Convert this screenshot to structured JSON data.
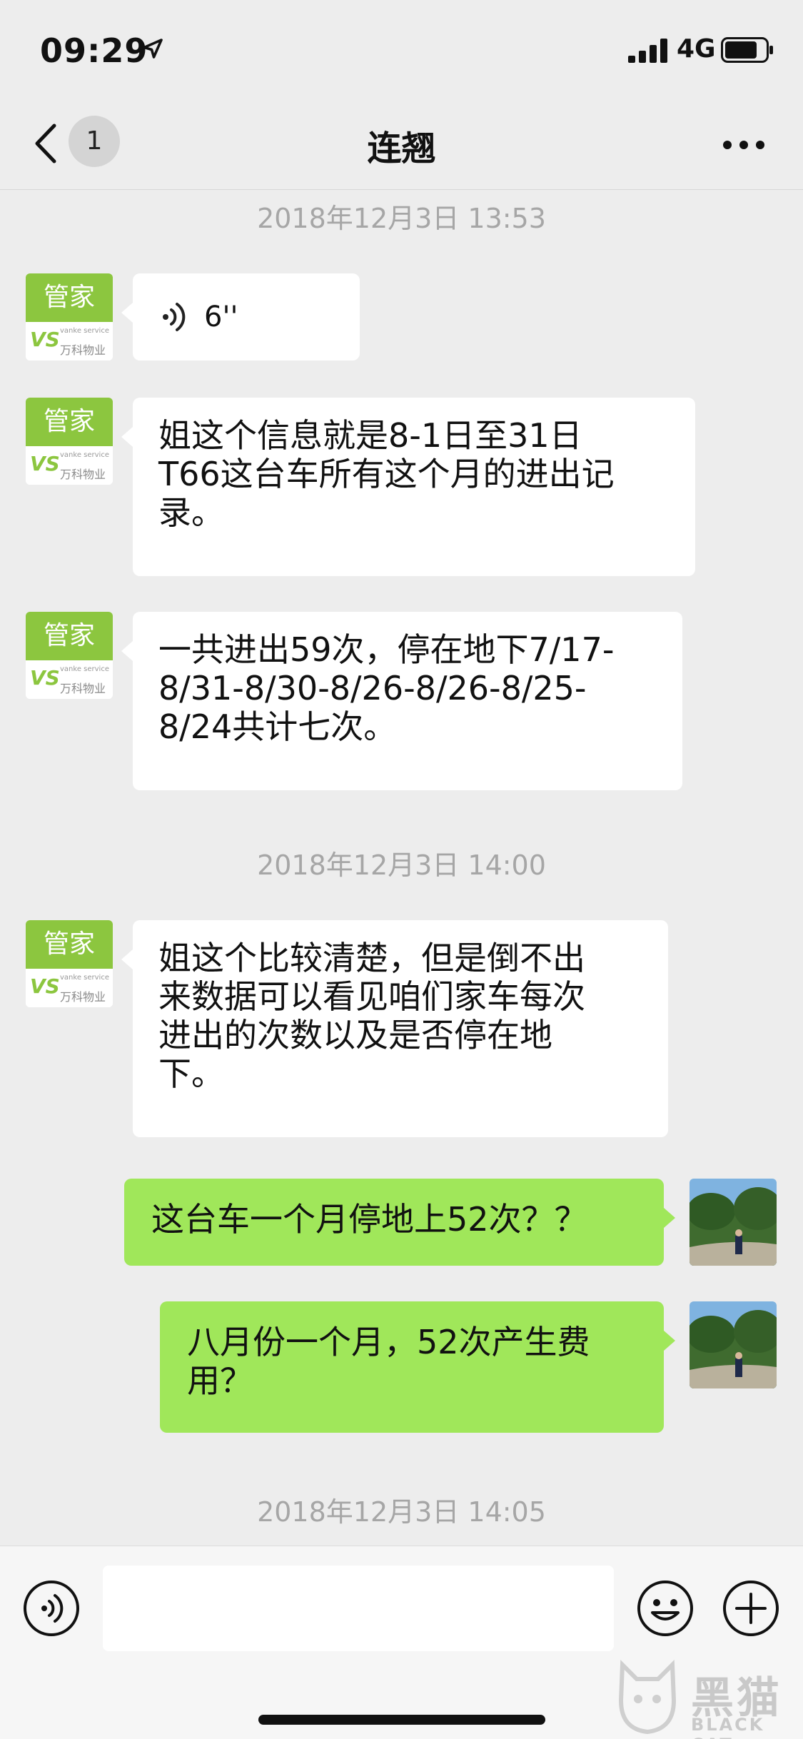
{
  "status": {
    "time": "09:29",
    "network": "4G"
  },
  "nav": {
    "unread_count": "1",
    "title": "连翘"
  },
  "avatar_brand": {
    "top": "管家",
    "sub": "vanke service",
    "cn": "万科物业"
  },
  "messages": {
    "ts1": "2018年12月3日 13:53",
    "voice_duration": "6''",
    "m1": [
      "姐这个信息就是8-1日至31日",
      "T66这台车所有这个月的进出记",
      "录。"
    ],
    "m2": [
      "一共进出59次，停在地下7/17-",
      "8/31-8/30-8/26-8/26-8/25-",
      "8/24共计七次。"
    ],
    "ts2": "2018年12月3日 14:00",
    "m3": [
      "姐这个比较清楚，但是倒不出",
      "来数据可以看见咱们家车每次",
      "进出的次数以及是否停在地",
      "下。"
    ],
    "m4": [
      "这台车一个月停地上52次？？"
    ],
    "m5": [
      "八月份一个月，52次产生费",
      "用？"
    ],
    "ts3": "2018年12月3日 14:05"
  },
  "input": {
    "value": ""
  },
  "watermark": {
    "cn": "黑猫",
    "en": "BLACK CAT"
  },
  "colors": {
    "self_bubble": "#a0e75a",
    "other_bubble": "#ffffff",
    "brand_green": "#8cc63f",
    "background": "#ededed"
  }
}
